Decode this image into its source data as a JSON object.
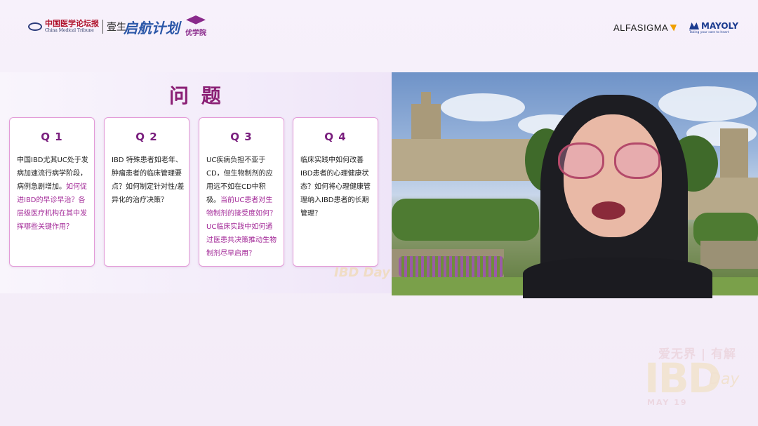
{
  "logos": {
    "cmt_zh": "中国医学论坛报",
    "cmt_en": "China Medical Tribune",
    "yisheng": "壹生",
    "jiming": "启航计划",
    "youxueyuan": "优学院",
    "alfasigma": "ALFASIGMA",
    "mayoly": "MAYOLY",
    "mayoly_tagline": "Taking your care to heart"
  },
  "slide": {
    "title": "问 题",
    "questions": [
      {
        "label": "Q 1",
        "text": "中国IBD尤其UC处于发病加速流行病学阶段，病例急剧增加。",
        "highlight": "如何促进IBD的早诊早治？各层级医疗机构在其中发挥哪些关键作用？"
      },
      {
        "label": "Q 2",
        "text": "IBD 特殊患者如老年、肿瘤患者的临床管理要点？如何制定针对性/差异化的治疗决策？",
        "highlight": ""
      },
      {
        "label": "Q 3",
        "text": "UC疾病负担不亚于CD，但生物制剂的应用远不如在CD中积极。",
        "highlight": "当前UC患者对生物制剂的接受度如何？UC临床实践中如何通过医患共决策推动生物制剂尽早启用？"
      },
      {
        "label": "Q 4",
        "text": "临床实践中如何改善IBD患者的心理健康状态？如何将心理健康管理纳入IBD患者的长期管理？",
        "highlight": ""
      }
    ],
    "watermark": "IBD Day"
  },
  "watermark": {
    "line1": "爱无界 | 有解",
    "ibd": "IBD",
    "day": "Day",
    "date": "MAY 19"
  },
  "colors": {
    "accent": "#8a1f74",
    "card_border": "#e39bd8",
    "highlight": "#a32a98"
  }
}
